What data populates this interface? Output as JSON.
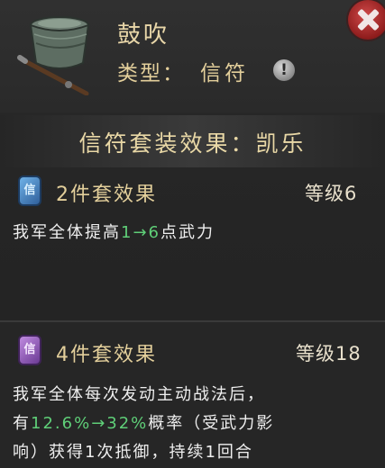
{
  "item": {
    "name": "鼓吹",
    "type_label": "类型：",
    "type_value": "信符"
  },
  "set": {
    "title": "信符套装效果：凯乐"
  },
  "effects": [
    {
      "icon": "blue-token-icon",
      "icon_char": "信",
      "title": "2件套效果",
      "level": "等级6",
      "desc_prefix": "我军全体提高",
      "desc_from": "1",
      "desc_arrow": "→",
      "desc_to": "6",
      "desc_suffix": "点武力"
    },
    {
      "icon": "purple-token-icon",
      "icon_char": "信",
      "title": "4件套效果",
      "level": "等级18",
      "line1": "我军全体每次发动主动战法后，",
      "line2_prefix": "有",
      "line2_from": "12.6%",
      "line2_arrow": "→",
      "line2_to": "32%",
      "line2_suffix": "概率（受武力影",
      "line3": "响）获得1次抵御，持续1回合"
    }
  ],
  "colors": {
    "accent_gold": "#e3cf9b",
    "green": "#5fcf78",
    "close_red": "#b53030"
  }
}
